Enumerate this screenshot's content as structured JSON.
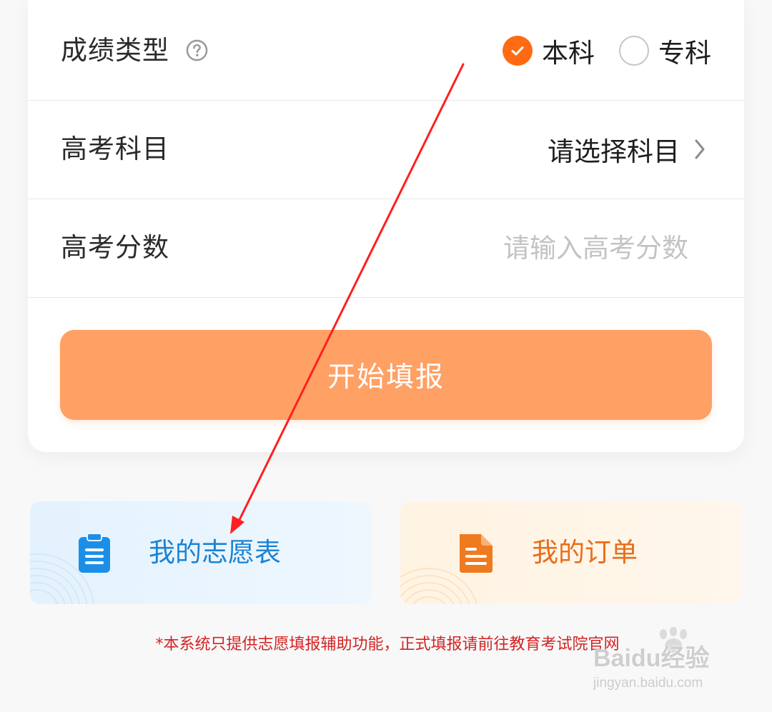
{
  "form": {
    "score_type": {
      "label": "成绩类型",
      "options": [
        {
          "label": "本科",
          "checked": true
        },
        {
          "label": "专科",
          "checked": false
        }
      ]
    },
    "subjects": {
      "label": "高考科目",
      "value": "请选择科目"
    },
    "score": {
      "label": "高考分数",
      "placeholder": "请输入高考分数",
      "value": ""
    },
    "submit_label": "开始填报"
  },
  "tiles": {
    "my_volunteer": {
      "label": "我的志愿表",
      "icon": "clipboard-icon"
    },
    "my_orders": {
      "label": "我的订单",
      "icon": "document-icon"
    }
  },
  "disclaimer": "*本系统只提供志愿填报辅助功能，正式填报请前往教育考试院官网",
  "watermark": {
    "brand": "Baidu经验",
    "url": "jingyan.baidu.com"
  },
  "colors": {
    "accent_orange": "#ff6a13",
    "button_orange": "#ffa064",
    "tile_blue_text": "#1b83d4",
    "tile_orange_text": "#e96d19",
    "disclaimer_red": "#d32323",
    "annotation_arrow": "#ff2020"
  }
}
